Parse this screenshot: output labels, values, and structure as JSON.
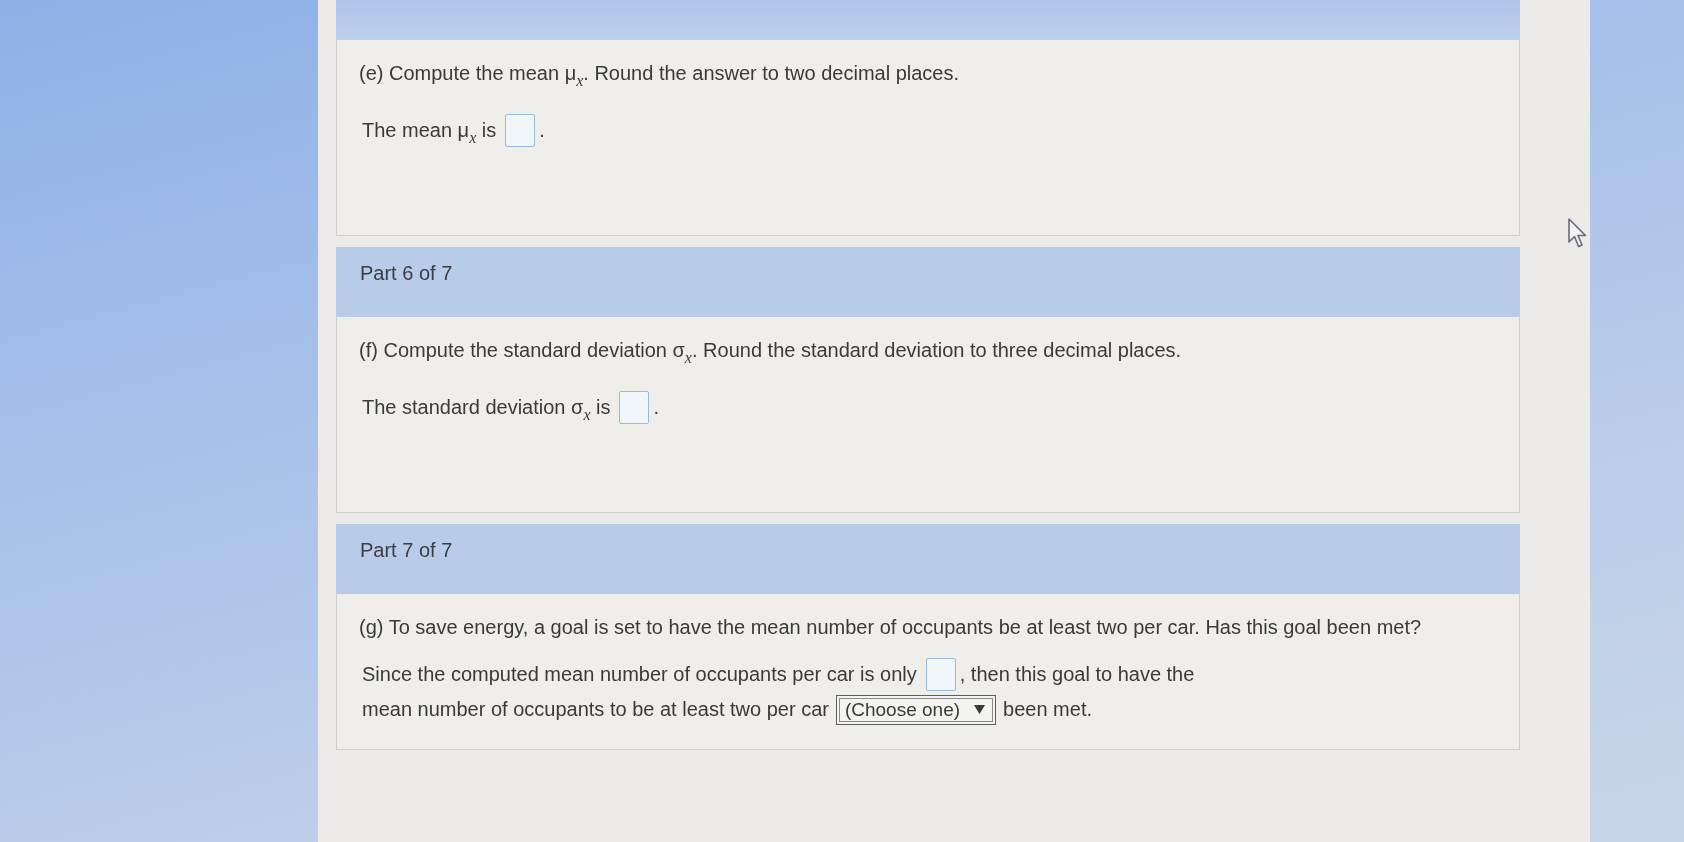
{
  "sections": [
    {
      "question": "(e) Compute the mean μ$_{x}$. Round the answer to two decimal places.",
      "answer_lines": [
        [
          {
            "kind": "text",
            "text": "The mean μ$_{x}$ is"
          },
          {
            "kind": "blank"
          },
          {
            "kind": "text",
            "text": "."
          }
        ]
      ]
    },
    {
      "header": "Part 6 of 7",
      "question": "(f) Compute the standard deviation σ$_{x}$. Round the standard deviation to three decimal places.",
      "answer_lines": [
        [
          {
            "kind": "text",
            "text": "The standard deviation σ$_{x}$ is"
          },
          {
            "kind": "blank"
          },
          {
            "kind": "text",
            "text": "."
          }
        ]
      ]
    },
    {
      "header": "Part 7 of 7",
      "question": "(g) To save energy, a goal is set to have the mean number of occupants be at least two per car. Has this goal been met?",
      "answer_lines": [
        [
          {
            "kind": "text",
            "text": "Since the computed mean number of occupants per car is only"
          },
          {
            "kind": "blank"
          },
          {
            "kind": "text",
            "text": ", then this goal to have the"
          }
        ],
        [
          {
            "kind": "text",
            "text": "mean number of occupants to be at least two per car"
          },
          {
            "kind": "dropdown",
            "value": "(Choose one)"
          },
          {
            "kind": "text",
            "text": "been met."
          }
        ]
      ]
    }
  ]
}
